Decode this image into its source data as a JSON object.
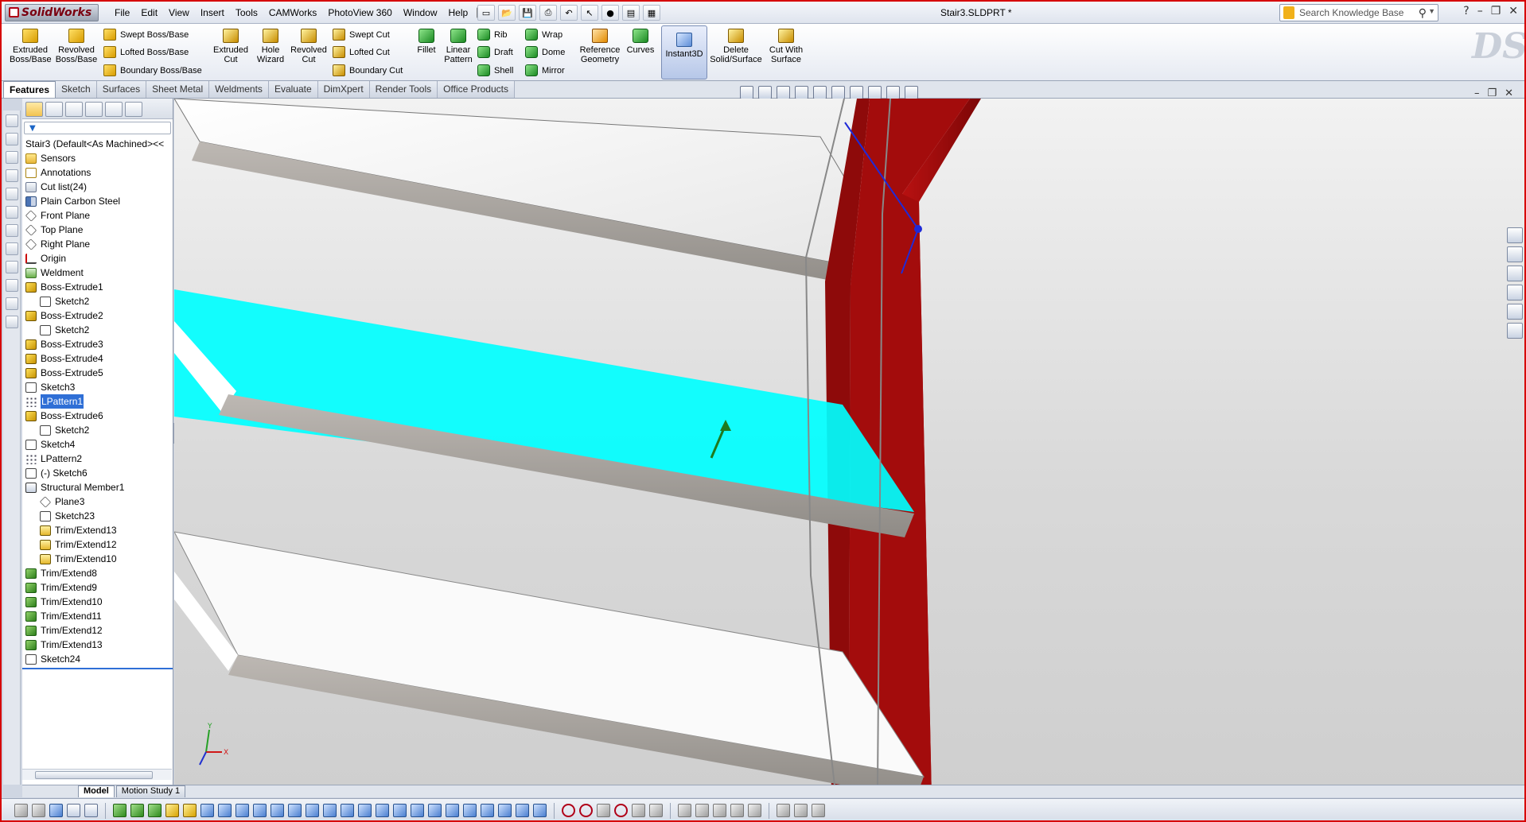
{
  "app": {
    "logo_text": "SolidWorks",
    "document_title": "Stair3.SLDPRT *"
  },
  "menu": [
    "File",
    "Edit",
    "View",
    "Insert",
    "Tools",
    "CAMWorks",
    "PhotoView 360",
    "Window",
    "Help"
  ],
  "search": {
    "placeholder": "Search Knowledge Base"
  },
  "window_controls": [
    "?",
    "–",
    "❐",
    "✕"
  ],
  "command_manager": {
    "extruded_boss": "Extruded Boss/Base",
    "revolved_boss": "Revolved Boss/Base",
    "swept_boss": "Swept Boss/Base",
    "lofted_boss": "Lofted Boss/Base",
    "boundary_boss": "Boundary Boss/Base",
    "extruded_cut": "Extruded Cut",
    "hole_wizard": "Hole Wizard",
    "revolved_cut": "Revolved Cut",
    "swept_cut": "Swept Cut",
    "lofted_cut": "Lofted Cut",
    "boundary_cut": "Boundary Cut",
    "fillet": "Fillet",
    "linear_pattern": "Linear Pattern",
    "rib": "Rib",
    "draft": "Draft",
    "shell": "Shell",
    "wrap": "Wrap",
    "dome": "Dome",
    "mirror": "Mirror",
    "reference_geometry": "Reference Geometry",
    "curves": "Curves",
    "instant3d": "Instant3D",
    "delete_solid": "Delete Solid/Surface",
    "cut_with_surface": "Cut With Surface"
  },
  "tabs": [
    {
      "label": "Features",
      "active": true
    },
    {
      "label": "Sketch",
      "active": false
    },
    {
      "label": "Surfaces",
      "active": false
    },
    {
      "label": "Sheet Metal",
      "active": false
    },
    {
      "label": "Weldments",
      "active": false
    },
    {
      "label": "Evaluate",
      "active": false
    },
    {
      "label": "DimXpert",
      "active": false
    },
    {
      "label": "Render Tools",
      "active": false
    },
    {
      "label": "Office Products",
      "active": false
    }
  ],
  "feature_tree": {
    "root": "Stair3  (Default<As Machined><<",
    "items": [
      {
        "label": "Sensors",
        "icon": "folder-icon",
        "indent": 0
      },
      {
        "label": "Annotations",
        "icon": "annotations-icon",
        "indent": 0
      },
      {
        "label": "Cut list(24)",
        "icon": "cut-list-icon",
        "indent": 0
      },
      {
        "label": "Plain Carbon Steel",
        "icon": "material-icon",
        "indent": 0
      },
      {
        "label": "Front Plane",
        "icon": "plane-icon",
        "indent": 0
      },
      {
        "label": "Top Plane",
        "icon": "plane-icon",
        "indent": 0
      },
      {
        "label": "Right Plane",
        "icon": "plane-icon",
        "indent": 0
      },
      {
        "label": "Origin",
        "icon": "origin-icon",
        "indent": 0
      },
      {
        "label": "Weldment",
        "icon": "weldment-icon",
        "indent": 0
      },
      {
        "label": "Boss-Extrude1",
        "icon": "extrude-icon",
        "indent": 0
      },
      {
        "label": "Sketch2",
        "icon": "sketch-icon",
        "indent": 1
      },
      {
        "label": "Boss-Extrude2",
        "icon": "extrude-icon",
        "indent": 0
      },
      {
        "label": "Sketch2",
        "icon": "sketch-icon",
        "indent": 1
      },
      {
        "label": "Boss-Extrude3",
        "icon": "extrude-icon",
        "indent": 0
      },
      {
        "label": "Boss-Extrude4",
        "icon": "extrude-icon",
        "indent": 0
      },
      {
        "label": "Boss-Extrude5",
        "icon": "extrude-icon",
        "indent": 0
      },
      {
        "label": "Sketch3",
        "icon": "sketch-icon",
        "indent": 0
      },
      {
        "label": "LPattern1",
        "icon": "pattern-icon",
        "indent": 0,
        "selected": true
      },
      {
        "label": "Boss-Extrude6",
        "icon": "extrude-icon",
        "indent": 0
      },
      {
        "label": "Sketch2",
        "icon": "sketch-icon",
        "indent": 1
      },
      {
        "label": "Sketch4",
        "icon": "sketch-icon",
        "indent": 0
      },
      {
        "label": "LPattern2",
        "icon": "pattern-icon",
        "indent": 0
      },
      {
        "label": "(-) Sketch6",
        "icon": "sketch-icon",
        "indent": 0
      },
      {
        "label": "Structural Member1",
        "icon": "structural-member-icon",
        "indent": 0
      },
      {
        "label": "Plane3",
        "icon": "plane-icon",
        "indent": 1
      },
      {
        "label": "Sketch23",
        "icon": "sketch-icon",
        "indent": 1
      },
      {
        "label": "Trim/Extend13",
        "icon": "trim-folder-icon",
        "indent": 1
      },
      {
        "label": "Trim/Extend12",
        "icon": "trim-folder-icon",
        "indent": 1
      },
      {
        "label": "Trim/Extend10",
        "icon": "trim-folder-icon",
        "indent": 1
      },
      {
        "label": "Trim/Extend8",
        "icon": "trim-extend-icon",
        "indent": 0
      },
      {
        "label": "Trim/Extend9",
        "icon": "trim-extend-icon",
        "indent": 0
      },
      {
        "label": "Trim/Extend10",
        "icon": "trim-extend-icon",
        "indent": 0
      },
      {
        "label": "Trim/Extend11",
        "icon": "trim-extend-icon",
        "indent": 0
      },
      {
        "label": "Trim/Extend12",
        "icon": "trim-extend-icon",
        "indent": 0
      },
      {
        "label": "Trim/Extend13",
        "icon": "trim-extend-icon",
        "indent": 0
      },
      {
        "label": "Sketch24",
        "icon": "sketch-icon",
        "indent": 0
      }
    ]
  },
  "bottom_tabs": [
    {
      "label": "Model",
      "active": true
    },
    {
      "label": "Motion Study 1",
      "active": false
    }
  ],
  "colors": {
    "selection_highlight": "#00ffff",
    "stringer": "#a30c0c",
    "frame_border": "#d60000"
  }
}
